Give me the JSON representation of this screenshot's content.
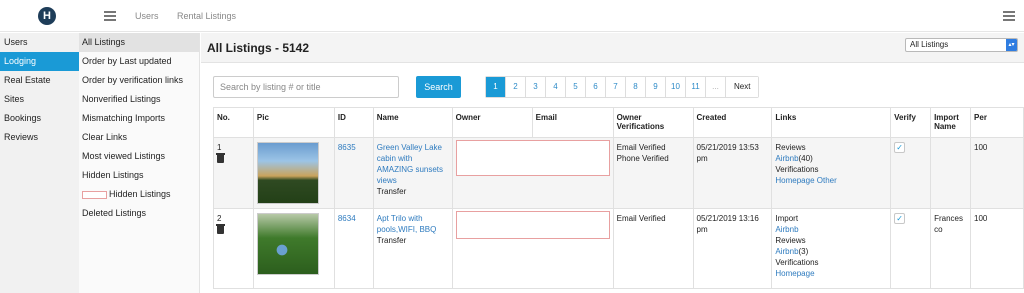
{
  "topbar": {
    "logo_letter": "H",
    "nav": [
      "Users",
      "Rental Listings"
    ]
  },
  "sidebar": {
    "items": [
      {
        "label": "Users",
        "active": false
      },
      {
        "label": "Lodging",
        "active": true
      },
      {
        "label": "Real Estate",
        "active": false
      },
      {
        "label": "Sites",
        "active": false
      },
      {
        "label": "Bookings",
        "active": false
      },
      {
        "label": "Reviews",
        "active": false
      }
    ]
  },
  "subnav": {
    "items": [
      "All Listings",
      "Order by Last updated",
      "Order by verification links",
      "Nonverified Listings",
      "Mismatching Imports",
      "Clear Links",
      "Most viewed Listings",
      "Hidden Listings",
      "Hidden Listings",
      "Deleted Listings"
    ]
  },
  "page": {
    "title": "All Listings - 5142",
    "filter_selected": "All Listings"
  },
  "search": {
    "placeholder": "Search by listing # or title",
    "button": "Search"
  },
  "pagination": [
    "1",
    "2",
    "3",
    "4",
    "5",
    "6",
    "7",
    "8",
    "9",
    "10",
    "11",
    "...",
    "Next"
  ],
  "table": {
    "headers": [
      "No.",
      "Pic",
      "ID",
      "Name",
      "Owner",
      "Email",
      "Owner Verifications",
      "Created",
      "Links",
      "Verify",
      "Import Name",
      "Per"
    ],
    "rows": [
      {
        "no": "1",
        "id": "8635",
        "name": "Green Valley Lake cabin with AMAZING sunsets views",
        "type": "Transfer",
        "verif1": "Email Verified",
        "verif2": "Phone Verified",
        "created": "05/21/2019 13:53 pm",
        "links": {
          "l1": "Reviews",
          "l2": "Airbnb",
          "l2b": "(40)",
          "l3": "Verifications",
          "l4": "Homepage Other"
        },
        "verify": "✓",
        "import": "",
        "per": "100"
      },
      {
        "no": "2",
        "id": "8634",
        "name": "Apt Trilo with pools,WIFI, BBQ",
        "type": "Transfer",
        "verif1": "Email Verified",
        "verif2": "",
        "created": "05/21/2019 13:16 pm",
        "links": {
          "l0": "Import",
          "l1": "Airbnb",
          "l2": "Reviews",
          "l3": "Airbnb",
          "l3b": "(3)",
          "l4": "Verifications",
          "l5": "Homepage"
        },
        "verify": "✓",
        "import": "Frances co",
        "per": "100"
      }
    ]
  },
  "colors": {
    "accent": "#1a9ad6",
    "link": "#2e7bbf"
  }
}
